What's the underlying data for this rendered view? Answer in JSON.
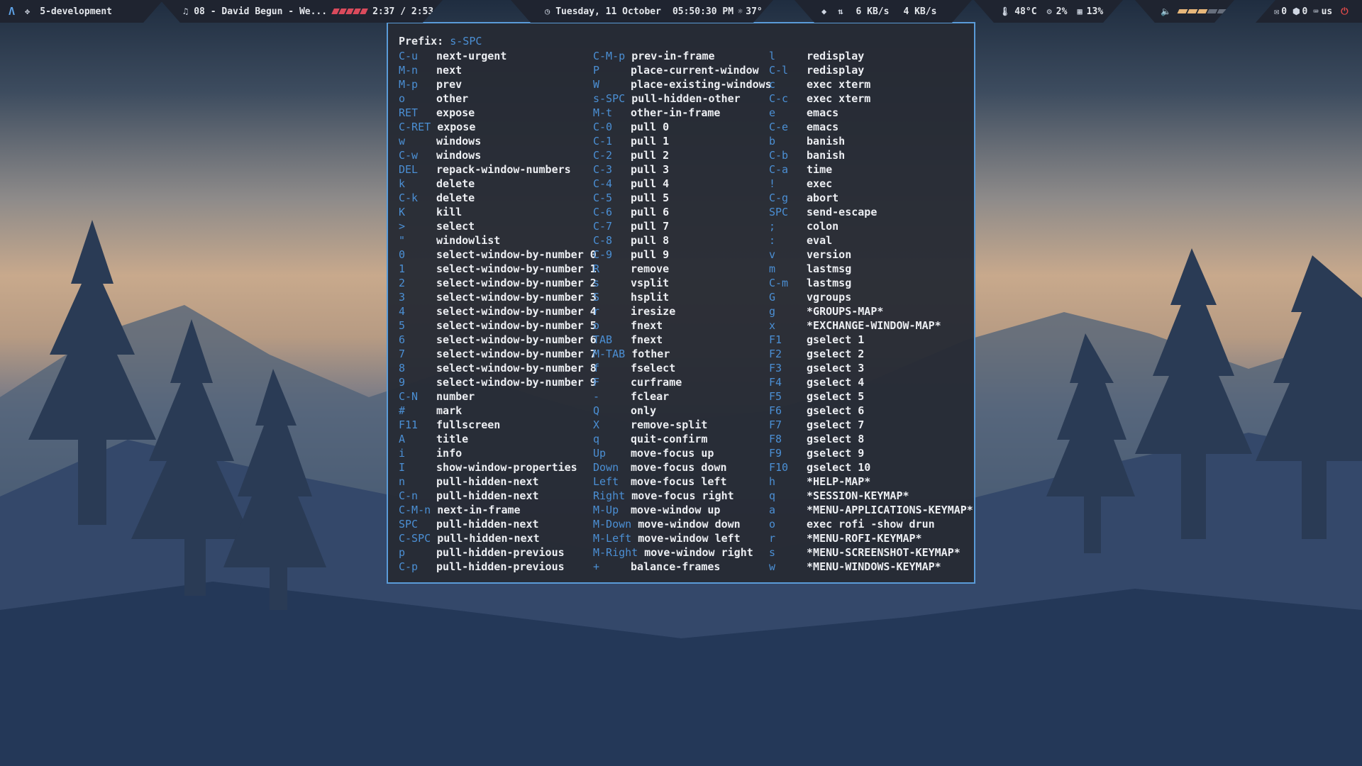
{
  "topbar": {
    "logo": "Λ",
    "workspace_icon": "✥",
    "workspace": "5-development",
    "music_note": "♫",
    "track": "08 - David Begun - We...",
    "track_progress_fraction": 0.95,
    "track_time": "2:37 / 2:53",
    "date": "Tuesday, 11 October",
    "time": "05:50:30 PM",
    "weather": "37°",
    "wifi_icon": "wifi-icon",
    "down_speed": "6 KB/s",
    "up_speed": "4 KB/s",
    "temp": "48°C",
    "cpu": "2%",
    "mem": "13%",
    "volume_level_fraction": 0.6,
    "mail_count": "0",
    "updates_count": "0",
    "kbd_layout": "us"
  },
  "keymap": {
    "prefix_label": "Prefix:",
    "prefix_value": "s-SPC",
    "columns": [
      [
        {
          "key": "C-u",
          "cmd": "next-urgent"
        },
        {
          "key": "M-n",
          "cmd": "next"
        },
        {
          "key": "M-p",
          "cmd": "prev"
        },
        {
          "key": "o",
          "cmd": "other"
        },
        {
          "key": "RET",
          "cmd": "expose"
        },
        {
          "key": "C-RET",
          "cmd": "expose"
        },
        {
          "key": "w",
          "cmd": "windows"
        },
        {
          "key": "C-w",
          "cmd": "windows"
        },
        {
          "key": "DEL",
          "cmd": "repack-window-numbers"
        },
        {
          "key": "k",
          "cmd": "delete"
        },
        {
          "key": "C-k",
          "cmd": "delete"
        },
        {
          "key": "K",
          "cmd": "kill"
        },
        {
          "key": ">",
          "cmd": "select"
        },
        {
          "key": "\"",
          "cmd": "windowlist"
        },
        {
          "key": "0",
          "cmd": "select-window-by-number 0"
        },
        {
          "key": "1",
          "cmd": "select-window-by-number 1"
        },
        {
          "key": "2",
          "cmd": "select-window-by-number 2"
        },
        {
          "key": "3",
          "cmd": "select-window-by-number 3"
        },
        {
          "key": "4",
          "cmd": "select-window-by-number 4"
        },
        {
          "key": "5",
          "cmd": "select-window-by-number 5"
        },
        {
          "key": "6",
          "cmd": "select-window-by-number 6"
        },
        {
          "key": "7",
          "cmd": "select-window-by-number 7"
        },
        {
          "key": "8",
          "cmd": "select-window-by-number 8"
        },
        {
          "key": "9",
          "cmd": "select-window-by-number 9"
        },
        {
          "key": "C-N",
          "cmd": "number"
        },
        {
          "key": "#",
          "cmd": "mark"
        },
        {
          "key": "F11",
          "cmd": "fullscreen"
        },
        {
          "key": "A",
          "cmd": "title"
        },
        {
          "key": "i",
          "cmd": "info"
        },
        {
          "key": "I",
          "cmd": "show-window-properties"
        },
        {
          "key": "n",
          "cmd": "pull-hidden-next"
        },
        {
          "key": "C-n",
          "cmd": "pull-hidden-next"
        },
        {
          "key": "C-M-n",
          "cmd": "next-in-frame"
        },
        {
          "key": "SPC",
          "cmd": "pull-hidden-next"
        },
        {
          "key": "C-SPC",
          "cmd": "pull-hidden-next"
        },
        {
          "key": "p",
          "cmd": "pull-hidden-previous"
        },
        {
          "key": "C-p",
          "cmd": "pull-hidden-previous"
        }
      ],
      [
        {
          "key": "C-M-p",
          "cmd": "prev-in-frame"
        },
        {
          "key": "P",
          "cmd": "place-current-window"
        },
        {
          "key": "W",
          "cmd": "place-existing-windows"
        },
        {
          "key": "s-SPC",
          "cmd": "pull-hidden-other"
        },
        {
          "key": "M-t",
          "cmd": "other-in-frame"
        },
        {
          "key": "C-0",
          "cmd": "pull 0"
        },
        {
          "key": "C-1",
          "cmd": "pull 1"
        },
        {
          "key": "C-2",
          "cmd": "pull 2"
        },
        {
          "key": "C-3",
          "cmd": "pull 3"
        },
        {
          "key": "C-4",
          "cmd": "pull 4"
        },
        {
          "key": "C-5",
          "cmd": "pull 5"
        },
        {
          "key": "C-6",
          "cmd": "pull 6"
        },
        {
          "key": "C-7",
          "cmd": "pull 7"
        },
        {
          "key": "C-8",
          "cmd": "pull 8"
        },
        {
          "key": "C-9",
          "cmd": "pull 9"
        },
        {
          "key": "R",
          "cmd": "remove"
        },
        {
          "key": "s",
          "cmd": "vsplit"
        },
        {
          "key": "S",
          "cmd": "hsplit"
        },
        {
          "key": "r",
          "cmd": "iresize"
        },
        {
          "key": "o",
          "cmd": "fnext"
        },
        {
          "key": "TAB",
          "cmd": "fnext"
        },
        {
          "key": "M-TAB",
          "cmd": "fother"
        },
        {
          "key": "f",
          "cmd": "fselect"
        },
        {
          "key": "F",
          "cmd": "curframe"
        },
        {
          "key": "-",
          "cmd": "fclear"
        },
        {
          "key": "Q",
          "cmd": "only"
        },
        {
          "key": "X",
          "cmd": "remove-split"
        },
        {
          "key": "q",
          "cmd": "quit-confirm"
        },
        {
          "key": "Up",
          "cmd": "move-focus up"
        },
        {
          "key": "Down",
          "cmd": "move-focus down"
        },
        {
          "key": "Left",
          "cmd": "move-focus left"
        },
        {
          "key": "Right",
          "cmd": "move-focus right"
        },
        {
          "key": "M-Up",
          "cmd": "move-window up"
        },
        {
          "key": "M-Down",
          "cmd": "move-window down"
        },
        {
          "key": "M-Left",
          "cmd": "move-window left"
        },
        {
          "key": "M-Right",
          "cmd": "move-window right"
        },
        {
          "key": "+",
          "cmd": "balance-frames"
        }
      ],
      [
        {
          "key": "l",
          "cmd": "redisplay"
        },
        {
          "key": "C-l",
          "cmd": "redisplay"
        },
        {
          "key": "c",
          "cmd": "exec xterm"
        },
        {
          "key": "C-c",
          "cmd": "exec xterm"
        },
        {
          "key": "e",
          "cmd": "emacs"
        },
        {
          "key": "C-e",
          "cmd": "emacs"
        },
        {
          "key": "b",
          "cmd": "banish"
        },
        {
          "key": "C-b",
          "cmd": "banish"
        },
        {
          "key": "C-a",
          "cmd": "time"
        },
        {
          "key": "!",
          "cmd": "exec"
        },
        {
          "key": "C-g",
          "cmd": "abort"
        },
        {
          "key": "SPC",
          "cmd": "send-escape"
        },
        {
          "key": ";",
          "cmd": "colon"
        },
        {
          "key": ":",
          "cmd": "eval"
        },
        {
          "key": "v",
          "cmd": "version"
        },
        {
          "key": "m",
          "cmd": "lastmsg"
        },
        {
          "key": "C-m",
          "cmd": "lastmsg"
        },
        {
          "key": "G",
          "cmd": "vgroups"
        },
        {
          "key": "g",
          "cmd": "*GROUPS-MAP*"
        },
        {
          "key": "x",
          "cmd": "*EXCHANGE-WINDOW-MAP*"
        },
        {
          "key": "F1",
          "cmd": "gselect 1"
        },
        {
          "key": "F2",
          "cmd": "gselect 2"
        },
        {
          "key": "F3",
          "cmd": "gselect 3"
        },
        {
          "key": "F4",
          "cmd": "gselect 4"
        },
        {
          "key": "F5",
          "cmd": "gselect 5"
        },
        {
          "key": "F6",
          "cmd": "gselect 6"
        },
        {
          "key": "F7",
          "cmd": "gselect 7"
        },
        {
          "key": "F8",
          "cmd": "gselect 8"
        },
        {
          "key": "F9",
          "cmd": "gselect 9"
        },
        {
          "key": "F10",
          "cmd": "gselect 10"
        },
        {
          "key": "h",
          "cmd": "*HELP-MAP*"
        },
        {
          "key": "q",
          "cmd": "*SESSION-KEYMAP*"
        },
        {
          "key": "a",
          "cmd": "*MENU-APPLICATIONS-KEYMAP*"
        },
        {
          "key": "o",
          "cmd": "exec rofi -show drun"
        },
        {
          "key": "r",
          "cmd": "*MENU-ROFI-KEYMAP*"
        },
        {
          "key": "s",
          "cmd": "*MENU-SCREENSHOT-KEYMAP*"
        },
        {
          "key": "w",
          "cmd": "*MENU-WINDOWS-KEYMAP*"
        }
      ]
    ]
  }
}
